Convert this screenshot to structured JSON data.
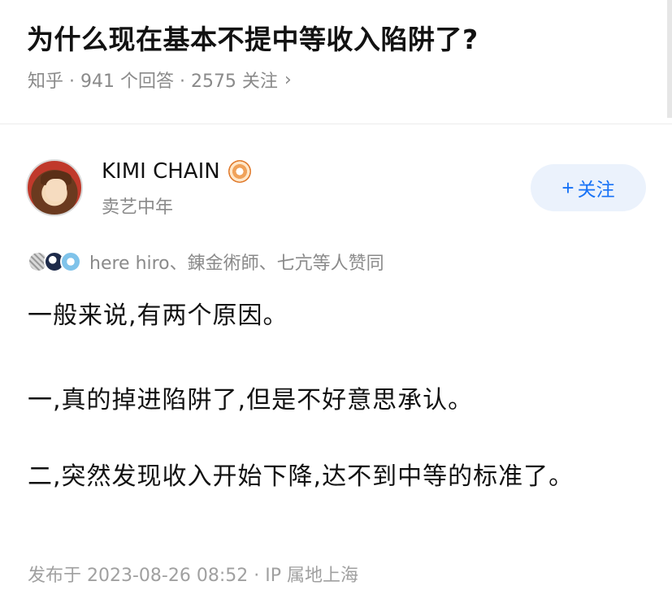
{
  "question": {
    "title": "为什么现在基本不提中等收入陷阱了?",
    "meta": "知乎 · 941 个回答 · 2575 关注",
    "chevron": "›"
  },
  "author": {
    "name": "KIMI CHAIN",
    "headline": "卖艺中年",
    "avatar_icon": "avatar-anime-character",
    "badge_icon": "eye-badge-icon"
  },
  "follow_button": {
    "plus": "+",
    "label": "关注"
  },
  "upvoters": {
    "text": "here hiro、錬金術師、七亢等人赞同"
  },
  "answer": {
    "paragraphs": [
      "一般来说,有两个原因。",
      "一,真的掉进陷阱了,但是不好意思承认。",
      "二,突然发现收入开始下降,达不到中等的标准了。"
    ]
  },
  "footer": {
    "post_time": "发布于 2023-08-26 08:52 · IP 属地上海"
  },
  "colors": {
    "accent": "#1772f6",
    "follow_bg": "#ebf2fc",
    "meta_text": "#8a8a8a"
  }
}
